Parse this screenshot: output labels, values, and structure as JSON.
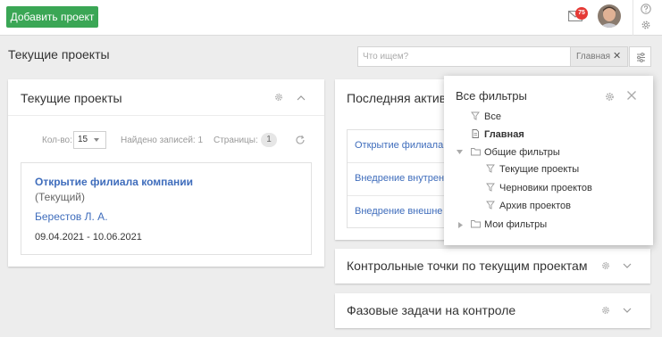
{
  "topbar": {
    "add_project_label": "Добавить проект",
    "mail_badge_count": "75"
  },
  "page": {
    "title": "Текущие проекты"
  },
  "search": {
    "placeholder": "Что ищем?",
    "active_filter_label": "Главная",
    "clear_symbol": "✕"
  },
  "current_projects_panel": {
    "title": "Текущие проекты",
    "count_label": "Кол-во:",
    "count_value": "15",
    "found_label": "Найдено записей: 1",
    "pages_label": "Страницы:",
    "pages_value": "1",
    "project": {
      "title": "Открытие филиала компании",
      "status": "(Текущий)",
      "person": "Берестов Л. А.",
      "dates": "09.04.2021 - 10.06.2021"
    }
  },
  "activity_panel": {
    "title": "Последняя активн",
    "items": [
      "Открытие филиала",
      "Внедрение внутрен",
      "Внедрение внешне"
    ]
  },
  "checkpoints_panel": {
    "title": "Контрольные точки по текущим проектам"
  },
  "phase_tasks_panel": {
    "title": "Фазовые задачи на контроле"
  },
  "filters_dropdown": {
    "title": "Все фильтры",
    "all": "Все",
    "main": "Главная",
    "common_group": "Общие фильтры",
    "common_items": [
      "Текущие проекты",
      "Черновики проектов",
      "Архив проектов"
    ],
    "my_group": "Мои фильтры"
  },
  "colors": {
    "accent_green": "#3aa655",
    "link_blue": "#3f6dbc",
    "badge_red": "#e53935"
  }
}
